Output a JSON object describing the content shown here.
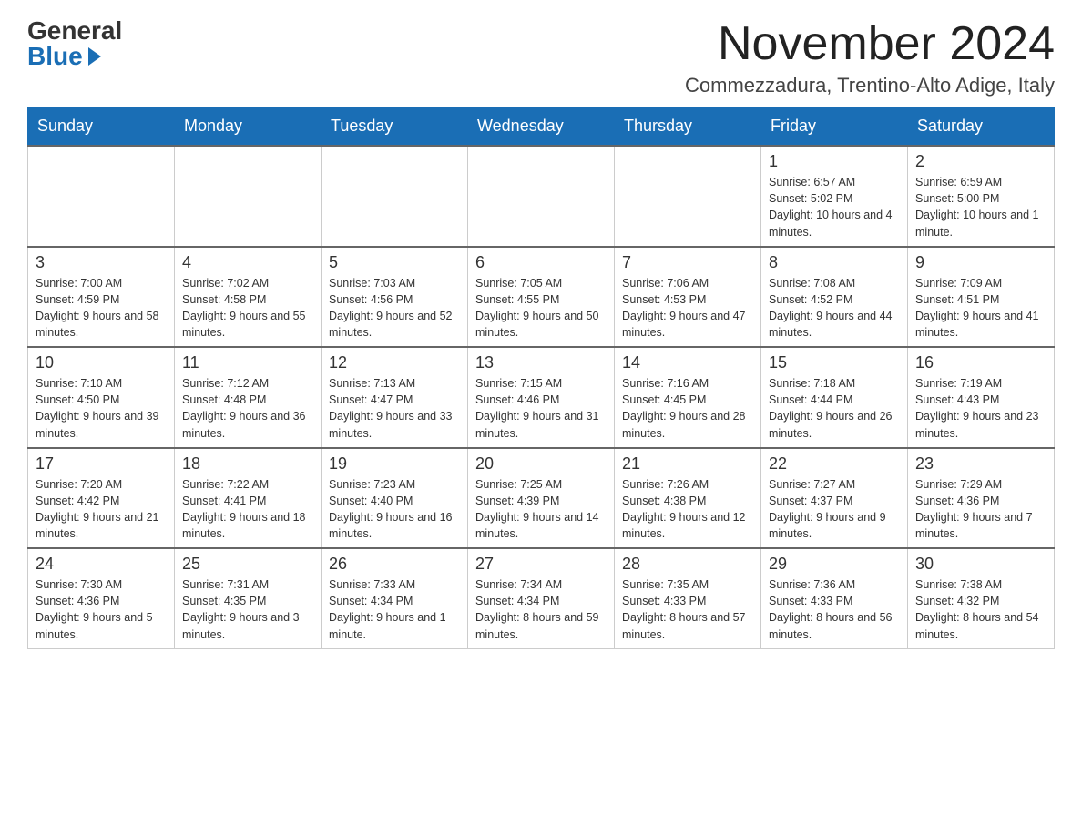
{
  "header": {
    "logo_general": "General",
    "logo_blue": "Blue",
    "month_title": "November 2024",
    "location": "Commezzadura, Trentino-Alto Adige, Italy"
  },
  "days_of_week": [
    "Sunday",
    "Monday",
    "Tuesday",
    "Wednesday",
    "Thursday",
    "Friday",
    "Saturday"
  ],
  "weeks": [
    [
      {
        "day": "",
        "info": ""
      },
      {
        "day": "",
        "info": ""
      },
      {
        "day": "",
        "info": ""
      },
      {
        "day": "",
        "info": ""
      },
      {
        "day": "",
        "info": ""
      },
      {
        "day": "1",
        "info": "Sunrise: 6:57 AM\nSunset: 5:02 PM\nDaylight: 10 hours and 4 minutes."
      },
      {
        "day": "2",
        "info": "Sunrise: 6:59 AM\nSunset: 5:00 PM\nDaylight: 10 hours and 1 minute."
      }
    ],
    [
      {
        "day": "3",
        "info": "Sunrise: 7:00 AM\nSunset: 4:59 PM\nDaylight: 9 hours and 58 minutes."
      },
      {
        "day": "4",
        "info": "Sunrise: 7:02 AM\nSunset: 4:58 PM\nDaylight: 9 hours and 55 minutes."
      },
      {
        "day": "5",
        "info": "Sunrise: 7:03 AM\nSunset: 4:56 PM\nDaylight: 9 hours and 52 minutes."
      },
      {
        "day": "6",
        "info": "Sunrise: 7:05 AM\nSunset: 4:55 PM\nDaylight: 9 hours and 50 minutes."
      },
      {
        "day": "7",
        "info": "Sunrise: 7:06 AM\nSunset: 4:53 PM\nDaylight: 9 hours and 47 minutes."
      },
      {
        "day": "8",
        "info": "Sunrise: 7:08 AM\nSunset: 4:52 PM\nDaylight: 9 hours and 44 minutes."
      },
      {
        "day": "9",
        "info": "Sunrise: 7:09 AM\nSunset: 4:51 PM\nDaylight: 9 hours and 41 minutes."
      }
    ],
    [
      {
        "day": "10",
        "info": "Sunrise: 7:10 AM\nSunset: 4:50 PM\nDaylight: 9 hours and 39 minutes."
      },
      {
        "day": "11",
        "info": "Sunrise: 7:12 AM\nSunset: 4:48 PM\nDaylight: 9 hours and 36 minutes."
      },
      {
        "day": "12",
        "info": "Sunrise: 7:13 AM\nSunset: 4:47 PM\nDaylight: 9 hours and 33 minutes."
      },
      {
        "day": "13",
        "info": "Sunrise: 7:15 AM\nSunset: 4:46 PM\nDaylight: 9 hours and 31 minutes."
      },
      {
        "day": "14",
        "info": "Sunrise: 7:16 AM\nSunset: 4:45 PM\nDaylight: 9 hours and 28 minutes."
      },
      {
        "day": "15",
        "info": "Sunrise: 7:18 AM\nSunset: 4:44 PM\nDaylight: 9 hours and 26 minutes."
      },
      {
        "day": "16",
        "info": "Sunrise: 7:19 AM\nSunset: 4:43 PM\nDaylight: 9 hours and 23 minutes."
      }
    ],
    [
      {
        "day": "17",
        "info": "Sunrise: 7:20 AM\nSunset: 4:42 PM\nDaylight: 9 hours and 21 minutes."
      },
      {
        "day": "18",
        "info": "Sunrise: 7:22 AM\nSunset: 4:41 PM\nDaylight: 9 hours and 18 minutes."
      },
      {
        "day": "19",
        "info": "Sunrise: 7:23 AM\nSunset: 4:40 PM\nDaylight: 9 hours and 16 minutes."
      },
      {
        "day": "20",
        "info": "Sunrise: 7:25 AM\nSunset: 4:39 PM\nDaylight: 9 hours and 14 minutes."
      },
      {
        "day": "21",
        "info": "Sunrise: 7:26 AM\nSunset: 4:38 PM\nDaylight: 9 hours and 12 minutes."
      },
      {
        "day": "22",
        "info": "Sunrise: 7:27 AM\nSunset: 4:37 PM\nDaylight: 9 hours and 9 minutes."
      },
      {
        "day": "23",
        "info": "Sunrise: 7:29 AM\nSunset: 4:36 PM\nDaylight: 9 hours and 7 minutes."
      }
    ],
    [
      {
        "day": "24",
        "info": "Sunrise: 7:30 AM\nSunset: 4:36 PM\nDaylight: 9 hours and 5 minutes."
      },
      {
        "day": "25",
        "info": "Sunrise: 7:31 AM\nSunset: 4:35 PM\nDaylight: 9 hours and 3 minutes."
      },
      {
        "day": "26",
        "info": "Sunrise: 7:33 AM\nSunset: 4:34 PM\nDaylight: 9 hours and 1 minute."
      },
      {
        "day": "27",
        "info": "Sunrise: 7:34 AM\nSunset: 4:34 PM\nDaylight: 8 hours and 59 minutes."
      },
      {
        "day": "28",
        "info": "Sunrise: 7:35 AM\nSunset: 4:33 PM\nDaylight: 8 hours and 57 minutes."
      },
      {
        "day": "29",
        "info": "Sunrise: 7:36 AM\nSunset: 4:33 PM\nDaylight: 8 hours and 56 minutes."
      },
      {
        "day": "30",
        "info": "Sunrise: 7:38 AM\nSunset: 4:32 PM\nDaylight: 8 hours and 54 minutes."
      }
    ]
  ]
}
